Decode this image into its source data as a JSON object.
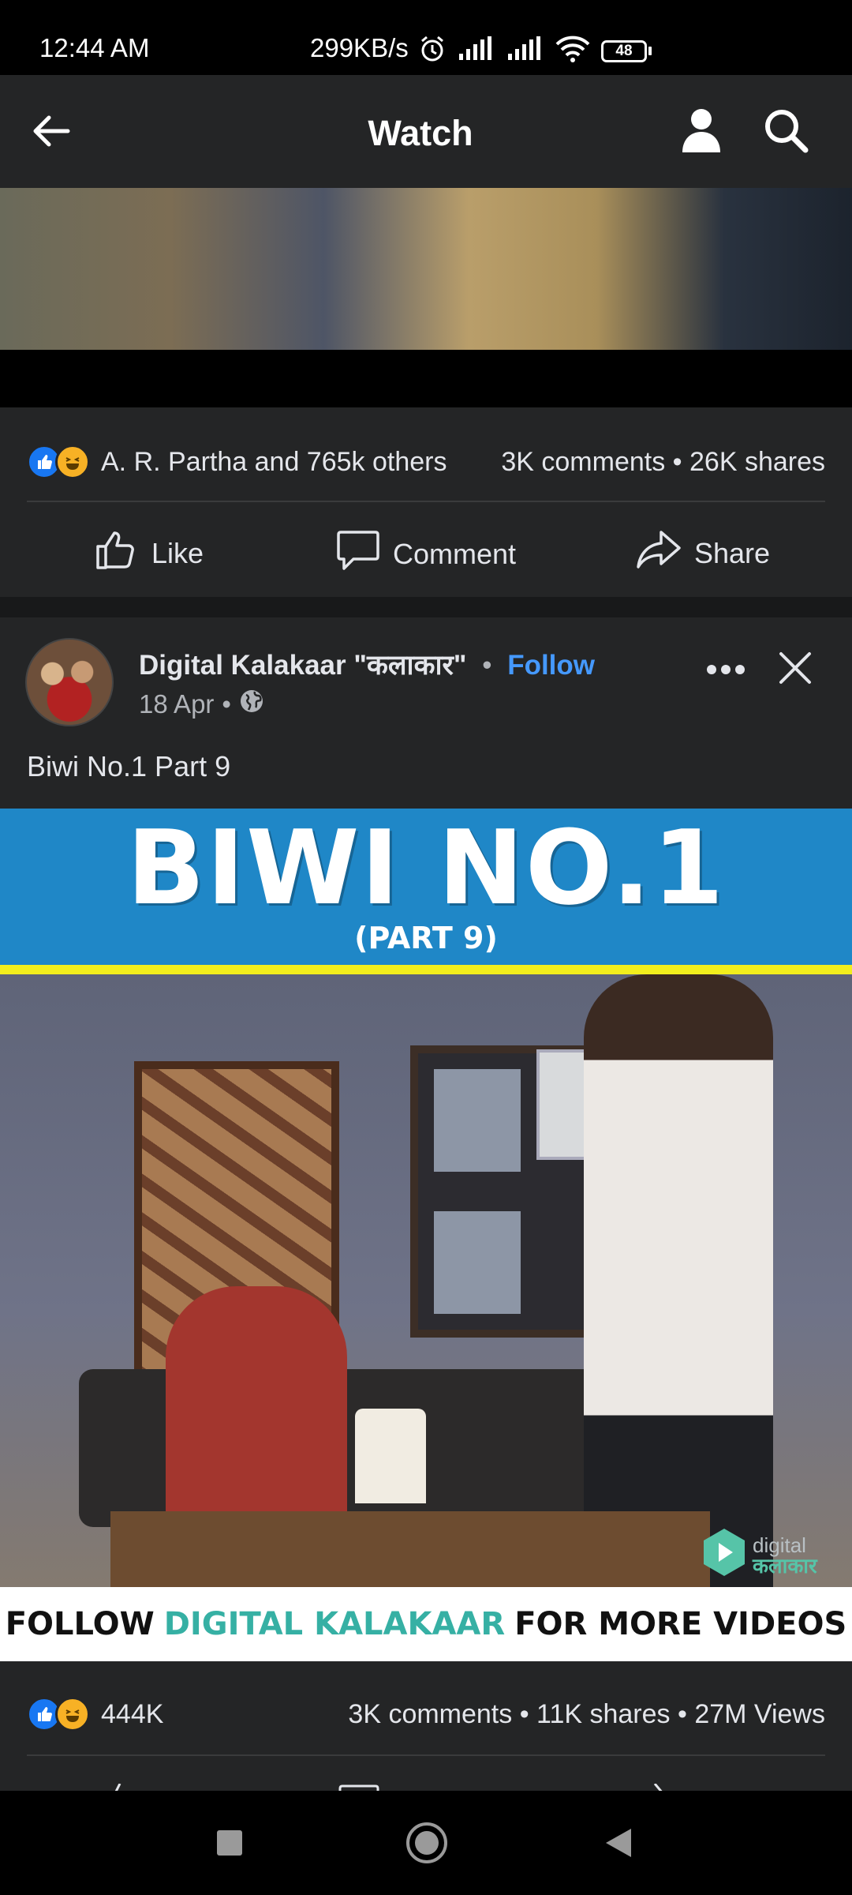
{
  "status_bar": {
    "time": "12:44 AM",
    "network_speed": "299KB/s",
    "battery": "48",
    "icons": [
      "alarm-icon",
      "signal-icon",
      "signal-icon",
      "wifi-icon",
      "battery-icon"
    ]
  },
  "header": {
    "title": "Watch",
    "icons": [
      "back-arrow-icon",
      "profile-icon",
      "search-icon"
    ]
  },
  "post1": {
    "reactions_text": "A. R. Partha and 765k others",
    "stats": "3K comments • 26K shares",
    "actions": {
      "like": "Like",
      "comment": "Comment",
      "share": "Share"
    }
  },
  "post2": {
    "page_name": "Digital Kalakaar \"कलाकार\"",
    "separator": "•",
    "follow": "Follow",
    "date": "18 Apr",
    "meta_separator": "•",
    "caption": "Biwi No.1 Part 9",
    "thumbnail": {
      "title": "BIWI NO.1",
      "subtitle": "(PART 9)",
      "watermark_line1": "digital",
      "watermark_line2": "कलाकार",
      "banner_prefix": "FOLLOW",
      "banner_accent": "DIGITAL KALAKAAR",
      "banner_suffix": "FOR MORE VIDEOS"
    },
    "reaction_count": "444K",
    "stats": "3K comments • 11K shares • 27M Views"
  },
  "colors": {
    "background": "#242526",
    "link_blue": "#4599ff",
    "like_blue": "#1877f2",
    "haha_yellow": "#f7b125",
    "banner_blue": "#1f87c7",
    "banner_accent": "#36b0a4"
  }
}
